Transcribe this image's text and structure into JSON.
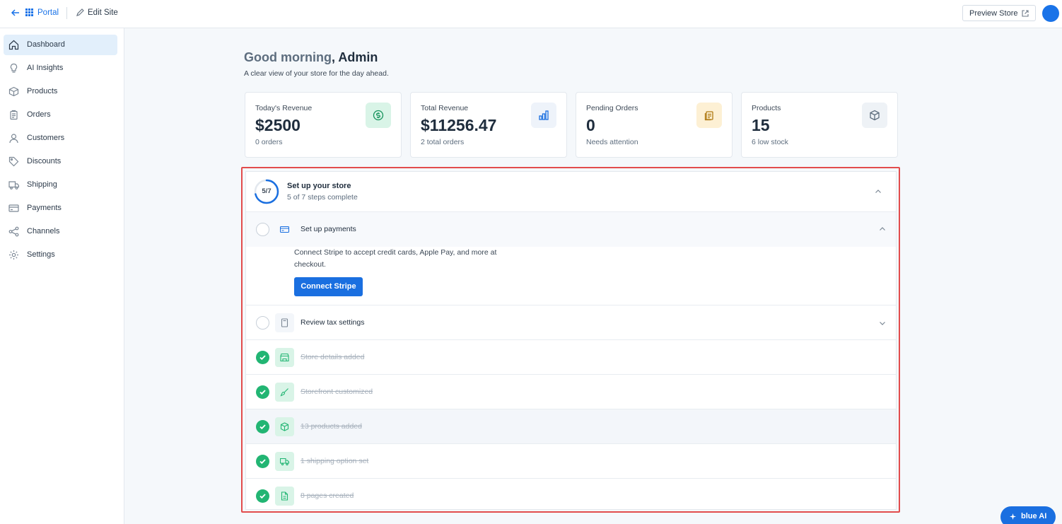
{
  "topbar": {
    "portal_label": "Portal",
    "edit_label": "Edit Site",
    "preview_label": "Preview Store"
  },
  "sidebar": {
    "items": [
      {
        "label": "Dashboard",
        "icon": "home-icon",
        "active": true
      },
      {
        "label": "AI Insights",
        "icon": "lightbulb-icon"
      },
      {
        "label": "Products",
        "icon": "box-icon"
      },
      {
        "label": "Orders",
        "icon": "clipboard-icon"
      },
      {
        "label": "Customers",
        "icon": "user-icon"
      },
      {
        "label": "Discounts",
        "icon": "tag-icon"
      },
      {
        "label": "Shipping",
        "icon": "truck-icon"
      },
      {
        "label": "Payments",
        "icon": "credit-card-icon"
      },
      {
        "label": "Channels",
        "icon": "share-icon"
      },
      {
        "label": "Settings",
        "icon": "gear-icon"
      }
    ]
  },
  "greeting": {
    "prefix": "Good morning",
    "name": ", Admin",
    "subtitle": "A clear view of your store for the day ahead."
  },
  "stats": [
    {
      "title": "Today's Revenue",
      "value": "$2500",
      "sub": "0 orders",
      "icon": "dollar-icon",
      "color": "#d9f4e7"
    },
    {
      "title": "Total Revenue",
      "value": "$11256.47",
      "sub": "2 total orders",
      "icon": "bar-chart-icon",
      "color": "#eef3fa"
    },
    {
      "title": "Pending Orders",
      "value": "0",
      "sub": "Needs attention",
      "icon": "clipboard-icon",
      "color": "#fdf0d4"
    },
    {
      "title": "Products",
      "value": "15",
      "sub": "6 low stock",
      "icon": "box-icon",
      "color": "#eef2f6"
    }
  ],
  "setup": {
    "progress_text": "5/7",
    "progress_fraction": 0.714,
    "title": "Set up your store",
    "subtitle": "5 of 7 steps complete",
    "payments": {
      "label": "Set up payments",
      "description": "Connect Stripe to accept credit cards, Apple Pay, and more at checkout.",
      "button": "Connect Stripe"
    },
    "tax": {
      "label": "Review tax settings"
    },
    "done": [
      {
        "label": "Store details added",
        "icon": "store-icon"
      },
      {
        "label": "Storefront customized",
        "icon": "brush-icon"
      },
      {
        "label": "13 products added",
        "icon": "box-icon"
      },
      {
        "label": "1 shipping option set",
        "icon": "truck-icon"
      },
      {
        "label": "8 pages created",
        "icon": "file-icon"
      }
    ]
  },
  "assistant": {
    "label": "blue AI"
  },
  "colors": {
    "accent": "#1a6fe0",
    "success": "#22b573",
    "highlight": "#e24c4c"
  }
}
